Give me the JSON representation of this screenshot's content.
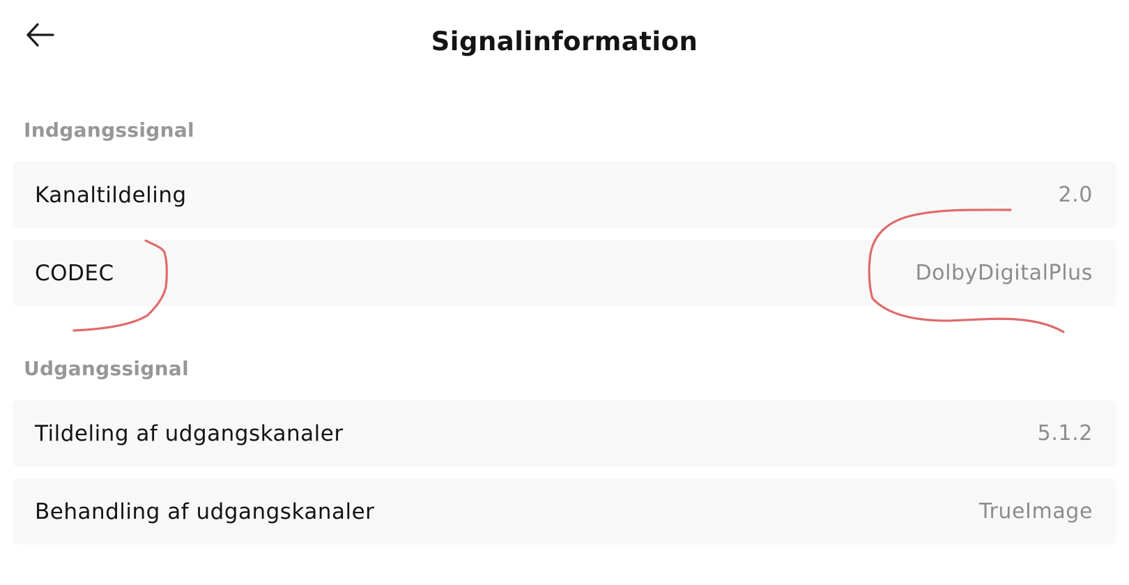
{
  "header": {
    "title": "Signalinformation",
    "back_icon": "arrow-left-icon"
  },
  "input_section": {
    "label": "Indgangssignal",
    "rows": [
      {
        "label": "Kanaltildeling",
        "value": "2.0"
      },
      {
        "label": "CODEC",
        "value": "DolbyDigitalPlus"
      }
    ]
  },
  "output_section": {
    "label": "Udgangssignal",
    "rows": [
      {
        "label": "Tildeling af udgangskanaler",
        "value": "5.1.2"
      },
      {
        "label": "Behandling af udgangskanaler",
        "value": "TrueImage"
      }
    ]
  },
  "colors": {
    "row_background": "#f8f8f8",
    "section_label": "#979797",
    "value_text": "#8c8c8c",
    "annotation_stroke": "#e06a6a"
  }
}
